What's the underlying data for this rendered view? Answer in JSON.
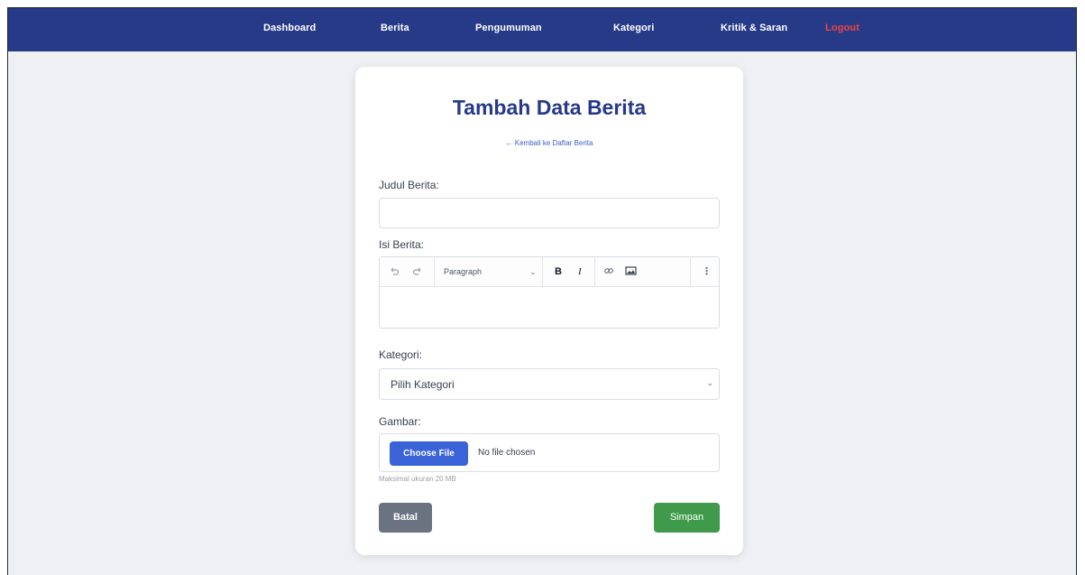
{
  "nav": {
    "items": [
      "Dashboard",
      "Berita",
      "Pengumuman",
      "Kategori",
      "Kritik & Saran",
      "Logout"
    ]
  },
  "form": {
    "title": "Tambah Data Berita",
    "back_link": "← Kembali ke Daftar Berita",
    "judul_label": "Judul Berita:",
    "judul_value": "",
    "isi_label": "Isi Berita:",
    "editor": {
      "undo_icon": "undo-icon",
      "redo_icon": "redo-icon",
      "paragraph_label": "Paragraph",
      "bold_label": "B",
      "italic_label": "I",
      "link_icon": "link-icon",
      "image_icon": "image-icon",
      "more_icon": "more-vertical-icon",
      "content": ""
    },
    "kategori_label": "Kategori:",
    "kategori_selected": "Pilih Kategori",
    "gambar_label": "Gambar:",
    "choose_file_label": "Choose File",
    "no_file_label": "No file chosen",
    "hint": "Maksimal ukuran 20 MB",
    "batal_label": "Batal",
    "simpan_label": "Simpan"
  },
  "colors": {
    "nav_bg": "#263a87",
    "title": "#263a87",
    "logout": "#ef4444",
    "choose_file": "#3a63d8",
    "batal": "#6b7280",
    "simpan": "#3f9b4b"
  }
}
